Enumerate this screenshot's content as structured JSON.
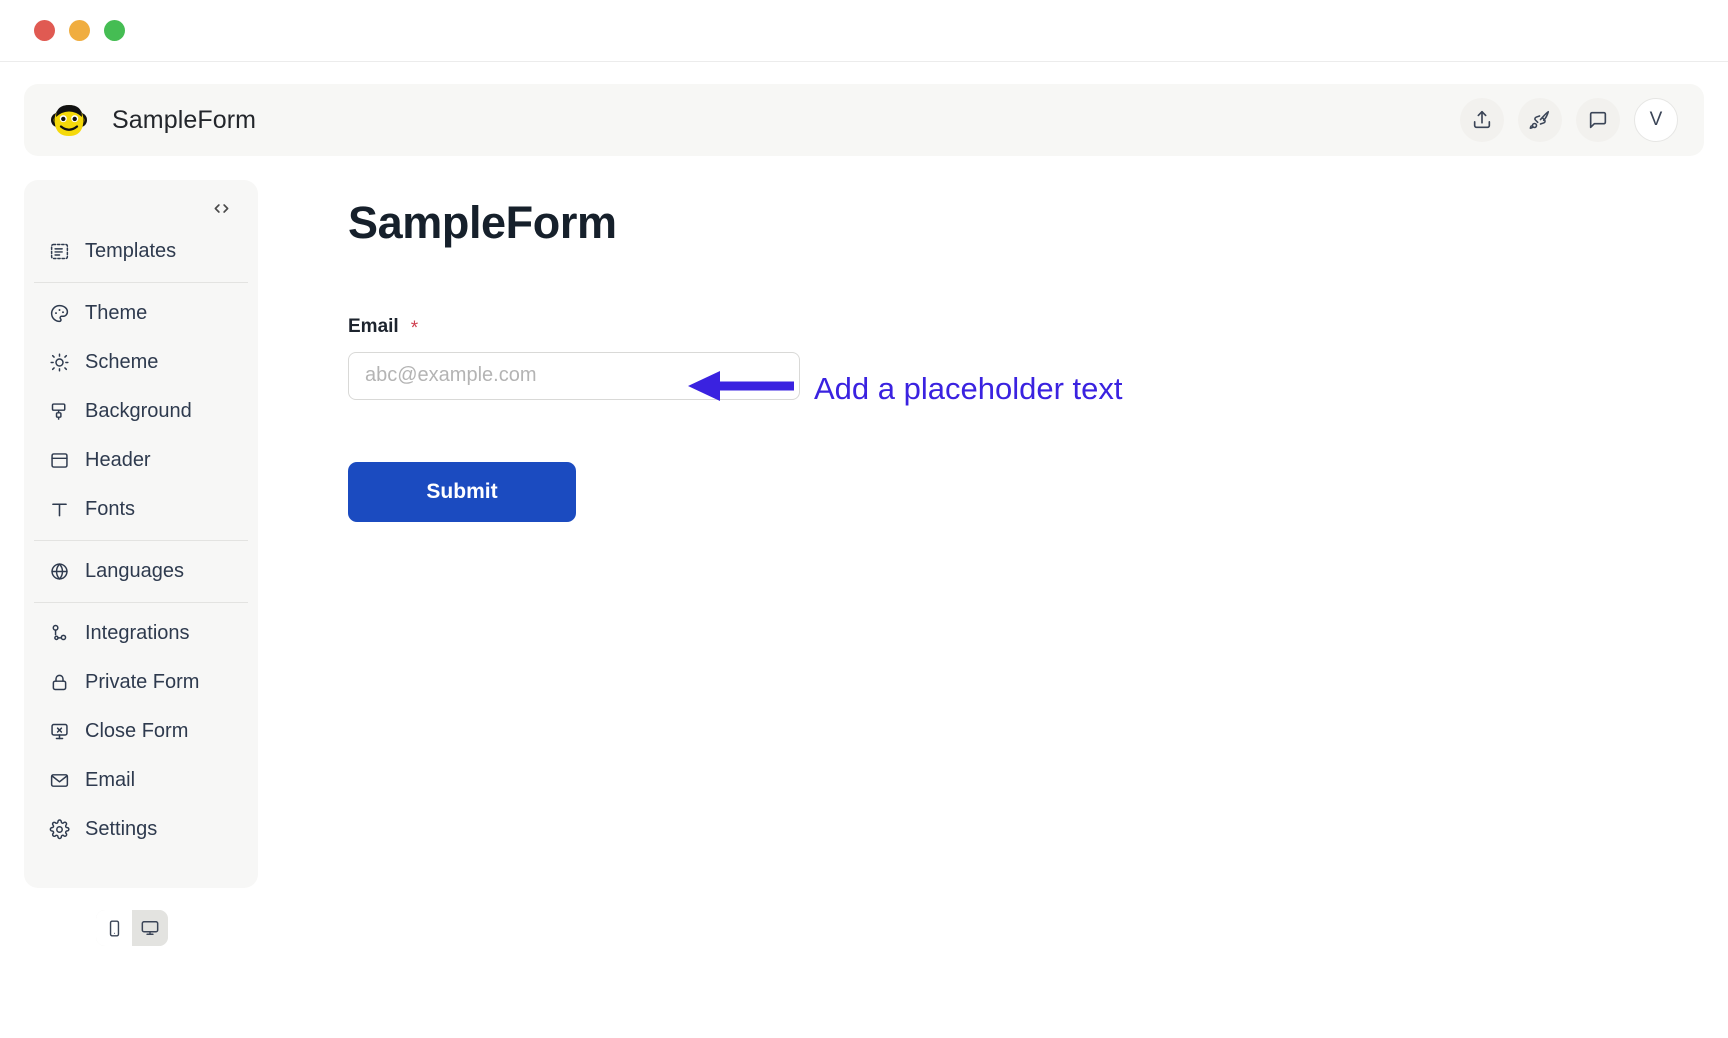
{
  "window": {
    "traffic_lights": [
      {
        "name": "close",
        "color": "#e05a52"
      },
      {
        "name": "minimize",
        "color": "#f0ad3f"
      },
      {
        "name": "zoom",
        "color": "#45bd53"
      }
    ]
  },
  "header": {
    "logo_icon": "monkey-face-logo",
    "title": "SampleForm",
    "actions": [
      {
        "icon": "share-upload-icon",
        "label": "Share"
      },
      {
        "icon": "rocket-publish-icon",
        "label": "Publish"
      },
      {
        "icon": "chat-bubble-icon",
        "label": "Feedback"
      }
    ],
    "avatar_initial": "V"
  },
  "sidebar": {
    "code_icon": "code-brackets-icon",
    "items": [
      {
        "label": "Templates",
        "icon": "templates-icon"
      },
      {
        "label": "Theme",
        "icon": "palette-icon"
      },
      {
        "label": "Scheme",
        "icon": "brightness-icon"
      },
      {
        "label": "Background",
        "icon": "paint-roller-icon"
      },
      {
        "label": "Header",
        "icon": "header-layout-icon"
      },
      {
        "label": "Fonts",
        "icon": "typography-icon"
      },
      {
        "label": "Languages",
        "icon": "globe-icon"
      },
      {
        "label": "Integrations",
        "icon": "integrations-icon"
      },
      {
        "label": "Private Form",
        "icon": "lock-icon"
      },
      {
        "label": "Close Form",
        "icon": "monitor-close-icon"
      },
      {
        "label": "Email",
        "icon": "envelope-icon"
      },
      {
        "label": "Settings",
        "icon": "gear-icon"
      }
    ],
    "device_toggle": {
      "mobile": {
        "icon": "mobile-icon",
        "selected": false
      },
      "desktop": {
        "icon": "desktop-icon",
        "selected": true
      }
    }
  },
  "form": {
    "title": "SampleForm",
    "fields": [
      {
        "label": "Email",
        "required_mark": "*",
        "value": "",
        "placeholder": "abc@example.com"
      }
    ],
    "submit_label": "Submit"
  },
  "annotation": {
    "text": "Add a placeholder text",
    "arrow_direction": "left",
    "color": "#3a22e0"
  },
  "colors": {
    "accent_button": "#1b4bc0",
    "annotation": "#3a22e0",
    "required": "#cf4050",
    "panel_bg": "#f7f7f5",
    "page_bg": "#ffffff"
  }
}
